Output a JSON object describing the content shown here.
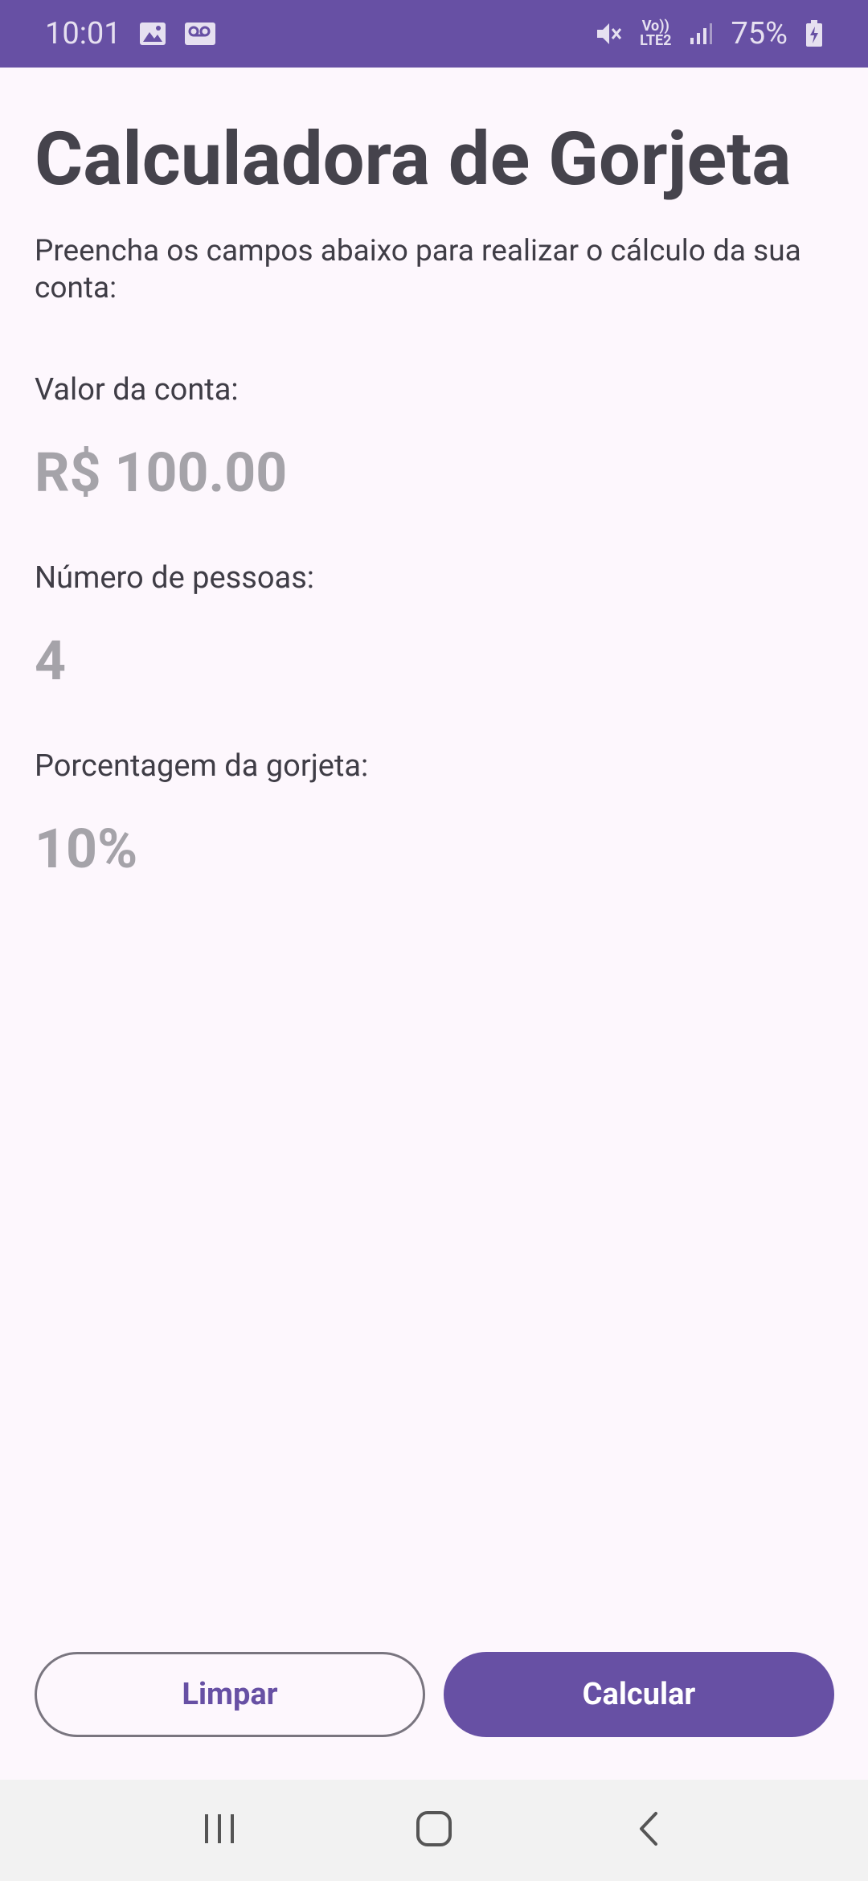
{
  "status_bar": {
    "time": "10:01",
    "network_top": "Vo))",
    "network_bottom": "LTE2",
    "battery_percent": "75%",
    "icons": [
      "gallery-icon",
      "voicemail-icon",
      "mute-icon",
      "signal-icon",
      "battery-charging-icon"
    ]
  },
  "main": {
    "title": "Calculadora de Gorjeta",
    "subtitle": "Preencha os campos abaixo para realizar o cálculo da sua conta:",
    "fields": [
      {
        "label": "Valor da conta:",
        "value": "R$ 100.00"
      },
      {
        "label": "Número de pessoas:",
        "value": "4"
      },
      {
        "label": "Porcentagem da gorjeta:",
        "value": "10%"
      }
    ]
  },
  "actions": {
    "clear_label": "Limpar",
    "calculate_label": "Calcular"
  },
  "colors": {
    "primary": "#6750a4",
    "background": "#fdf7fd",
    "text": "#45434c",
    "hint": "#a5a3a9"
  },
  "navigation": {
    "icons": [
      "recent-apps-icon",
      "home-icon",
      "back-icon"
    ]
  }
}
